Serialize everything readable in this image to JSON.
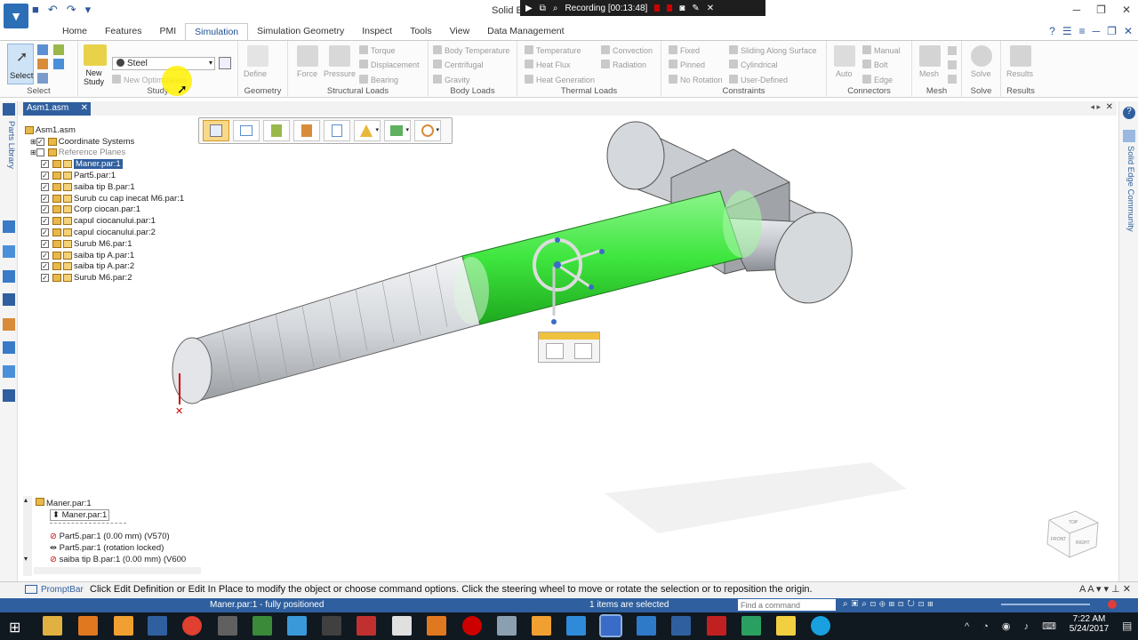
{
  "app": {
    "title": "Solid E",
    "recording": "Recording [00:13:48]"
  },
  "tabs": [
    "Home",
    "Features",
    "PMI",
    "Simulation",
    "Simulation Geometry",
    "Inspect",
    "Tools",
    "View",
    "Data Management"
  ],
  "active_tab": "Simulation",
  "ribbon": {
    "select": {
      "label": "Select",
      "group": "Select"
    },
    "study": {
      "new_study": "New\nStudy",
      "material": "Steel",
      "new_optimization": "New Optimization",
      "group": "Study"
    },
    "geometry": {
      "define": "Define",
      "group": "Geometry"
    },
    "structural": {
      "force": "Force",
      "pressure": "Pressure",
      "torque": "Torque",
      "displacement": "Displacement",
      "bearing": "Bearing",
      "group": "Structural Loads"
    },
    "body": {
      "body_temperature": "Body Temperature",
      "centrifugal": "Centrifugal",
      "gravity": "Gravity",
      "group": "Body Loads"
    },
    "thermal": {
      "temperature": "Temperature",
      "heat_flux": "Heat Flux",
      "heat_generation": "Heat Generation",
      "convection": "Convection",
      "radiation": "Radiation",
      "group": "Thermal Loads"
    },
    "constraints": {
      "fixed": "Fixed",
      "pinned": "Pinned",
      "no_rotation": "No Rotation",
      "sliding": "Sliding Along Surface",
      "cylindrical": "Cylindrical",
      "user_defined": "User-Defined",
      "group": "Constraints"
    },
    "connectors": {
      "auto": "Auto",
      "manual": "Manual",
      "bolt": "Bolt",
      "edge": "Edge",
      "group": "Connectors"
    },
    "mesh": {
      "mesh": "Mesh",
      "group": "Mesh"
    },
    "solve": {
      "solve": "Solve",
      "group": "Solve"
    },
    "results": {
      "results": "Results",
      "group": "Results"
    }
  },
  "document_tab": "Asm1.asm",
  "left_strip_label": "Parts Library",
  "right_strip_label": "Solid Edge Community",
  "pathfinder": {
    "root": "Asm1.asm",
    "items": [
      {
        "label": "Coordinate Systems",
        "checked": true
      },
      {
        "label": "Reference Planes",
        "checked": false
      },
      {
        "label": "Maner.par:1",
        "checked": true,
        "selected": true
      },
      {
        "label": "Part5.par:1",
        "checked": true
      },
      {
        "label": "saiba tip B.par:1",
        "checked": true
      },
      {
        "label": "Surub cu cap inecat M6.par:1",
        "checked": true
      },
      {
        "label": "Corp ciocan.par:1",
        "checked": true
      },
      {
        "label": "capul ciocanului.par:1",
        "checked": true
      },
      {
        "label": "capul ciocanului.par:2",
        "checked": true
      },
      {
        "label": "Surub M6.par:1",
        "checked": true
      },
      {
        "label": "saiba tip A.par:1",
        "checked": true
      },
      {
        "label": "saiba tip A.par:2",
        "checked": true
      },
      {
        "label": "Surub M6.par:2",
        "checked": true
      }
    ]
  },
  "relationships": {
    "title": "Maner.par:1",
    "sub": "Maner.par:1",
    "rows": [
      "Part5.par:1   (0.00 mm)   (V570)",
      "Part5.par:1   (rotation locked)",
      "saiba tip B.par:1   (0.00 mm)   (V600"
    ]
  },
  "prompt": {
    "label": "PromptBar",
    "text": "Click Edit Definition or Edit In Place to modify the object or choose command options. Click the steering wheel to move or rotate the selection or to reposition the origin."
  },
  "status": {
    "left": "Maner.par:1 - fully positioned",
    "middle": "1 items are selected",
    "search_placeholder": "Find a command"
  },
  "clock": {
    "time": "7:22 AM",
    "date": "5/24/2017"
  },
  "view_cube": {
    "labels": [
      "TOP",
      "FRONT",
      "RIGHT"
    ]
  },
  "colors": {
    "accent": "#2f5f9e",
    "highlight": "#33e633",
    "part": "#b8bcc4"
  }
}
